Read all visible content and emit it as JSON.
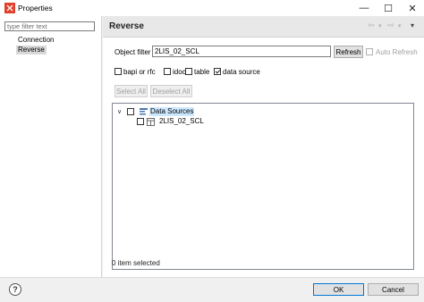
{
  "window": {
    "title": "Properties",
    "minimize_glyph": "—",
    "maximize_glyph": "☐",
    "close_glyph": "✕",
    "app_icon": "odi-icon",
    "app_icon_color": "#e0412c"
  },
  "left_panel": {
    "filter_placeholder": "type filter text",
    "items": [
      {
        "label": "Connection",
        "selected": false
      },
      {
        "label": "Reverse",
        "selected": true
      }
    ]
  },
  "header": {
    "title": "Reverse",
    "back_glyph": "⇦",
    "back_menu_glyph": "▾",
    "forward_glyph": "⇨",
    "forward_menu_glyph": "▾",
    "view_menu_glyph": "▾"
  },
  "reverse": {
    "object_filter_label": "Object filter",
    "object_filter_value": "2LIS_02_SCL",
    "refresh_label": "Refresh",
    "auto_refresh_label": "Auto Refresh",
    "auto_refresh_checked": false,
    "types": [
      {
        "label": "bapi or rfc",
        "checked": false
      },
      {
        "label": "idoc",
        "checked": false
      },
      {
        "label": "table",
        "checked": false
      },
      {
        "label": "data source",
        "checked": true
      }
    ],
    "select_all_label": "Select All",
    "deselect_all_label": "Deselect All"
  },
  "tree": {
    "expand_glyph": "∨",
    "root": {
      "label": "Data Sources",
      "checked": false,
      "expanded": true
    },
    "children": [
      {
        "label": "2LIS_02_SCL",
        "checked": false
      }
    ]
  },
  "status": {
    "text": "0 item selected"
  },
  "footer": {
    "help_glyph": "?",
    "ok_label": "OK",
    "cancel_label": "Cancel"
  }
}
